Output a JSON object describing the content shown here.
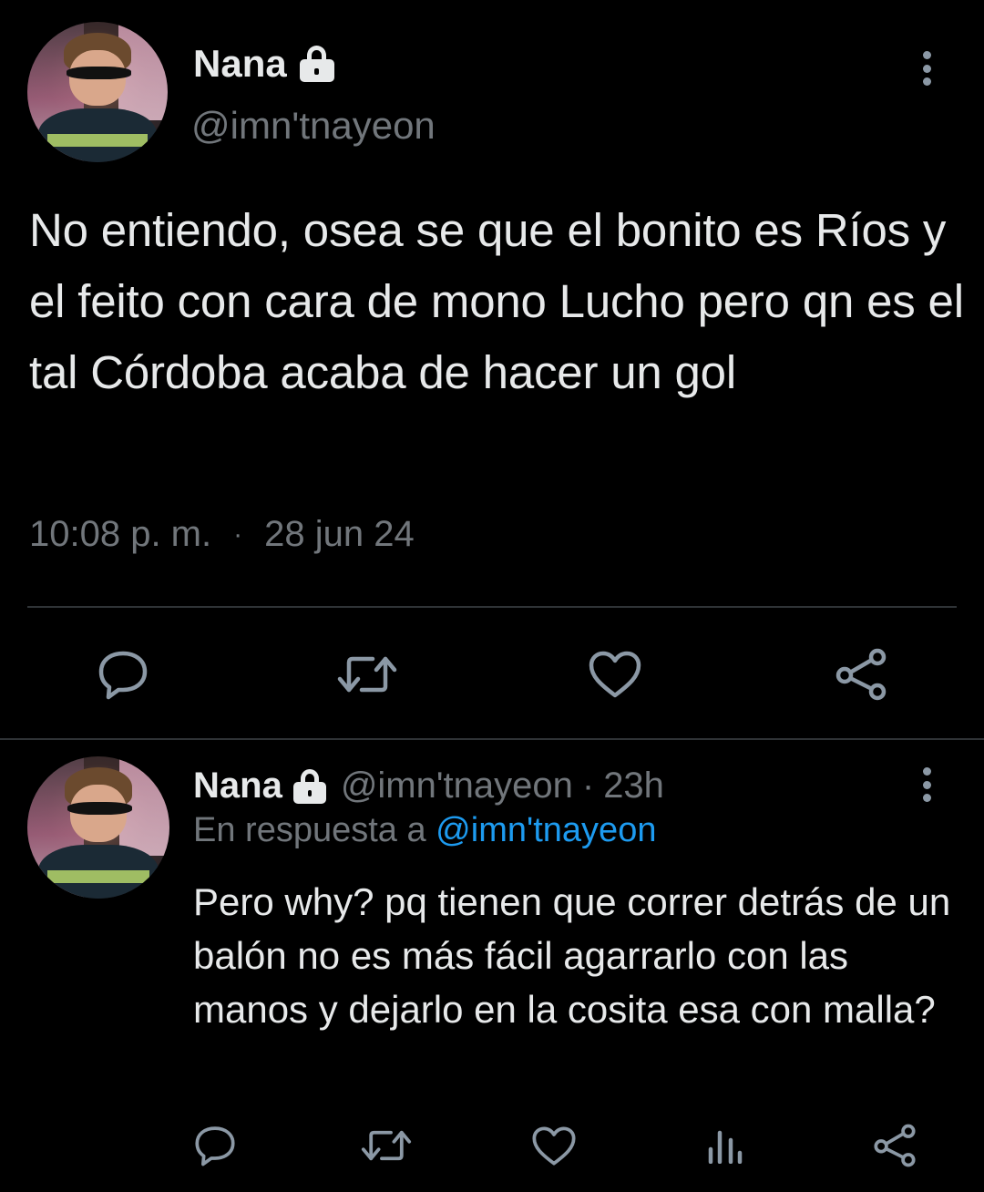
{
  "main_tweet": {
    "display_name": "Nana",
    "handle": "@imn'tnayeon",
    "text": "No entiendo, osea se que el bonito es Ríos y el feito con cara de mono Lucho pero qn es el tal Córdoba acaba de hacer un gol",
    "time": "10:08 p. m.",
    "separator": "·",
    "date": "28 jun 24",
    "actions": [
      "reply-icon",
      "retweet-icon",
      "like-icon",
      "share-icon"
    ]
  },
  "reply_tweet": {
    "display_name": "Nana",
    "handle": "@imn'tnayeon",
    "separator": "·",
    "age": "23h",
    "replying_prefix": "En respuesta a",
    "replying_to": "@imn'tnayeon",
    "text": "Pero why? pq tienen que correr detrás de un balón no es más fácil agarrarlo con las manos y dejarlo en la cosita esa con malla?",
    "actions": [
      "reply-icon",
      "retweet-icon",
      "like-icon",
      "views-icon",
      "share-icon"
    ]
  },
  "colors": {
    "background": "#000000",
    "primary_text": "#e7e9ea",
    "secondary_text": "#71767b",
    "link": "#1d9bf0",
    "divider": "#2f3336"
  }
}
